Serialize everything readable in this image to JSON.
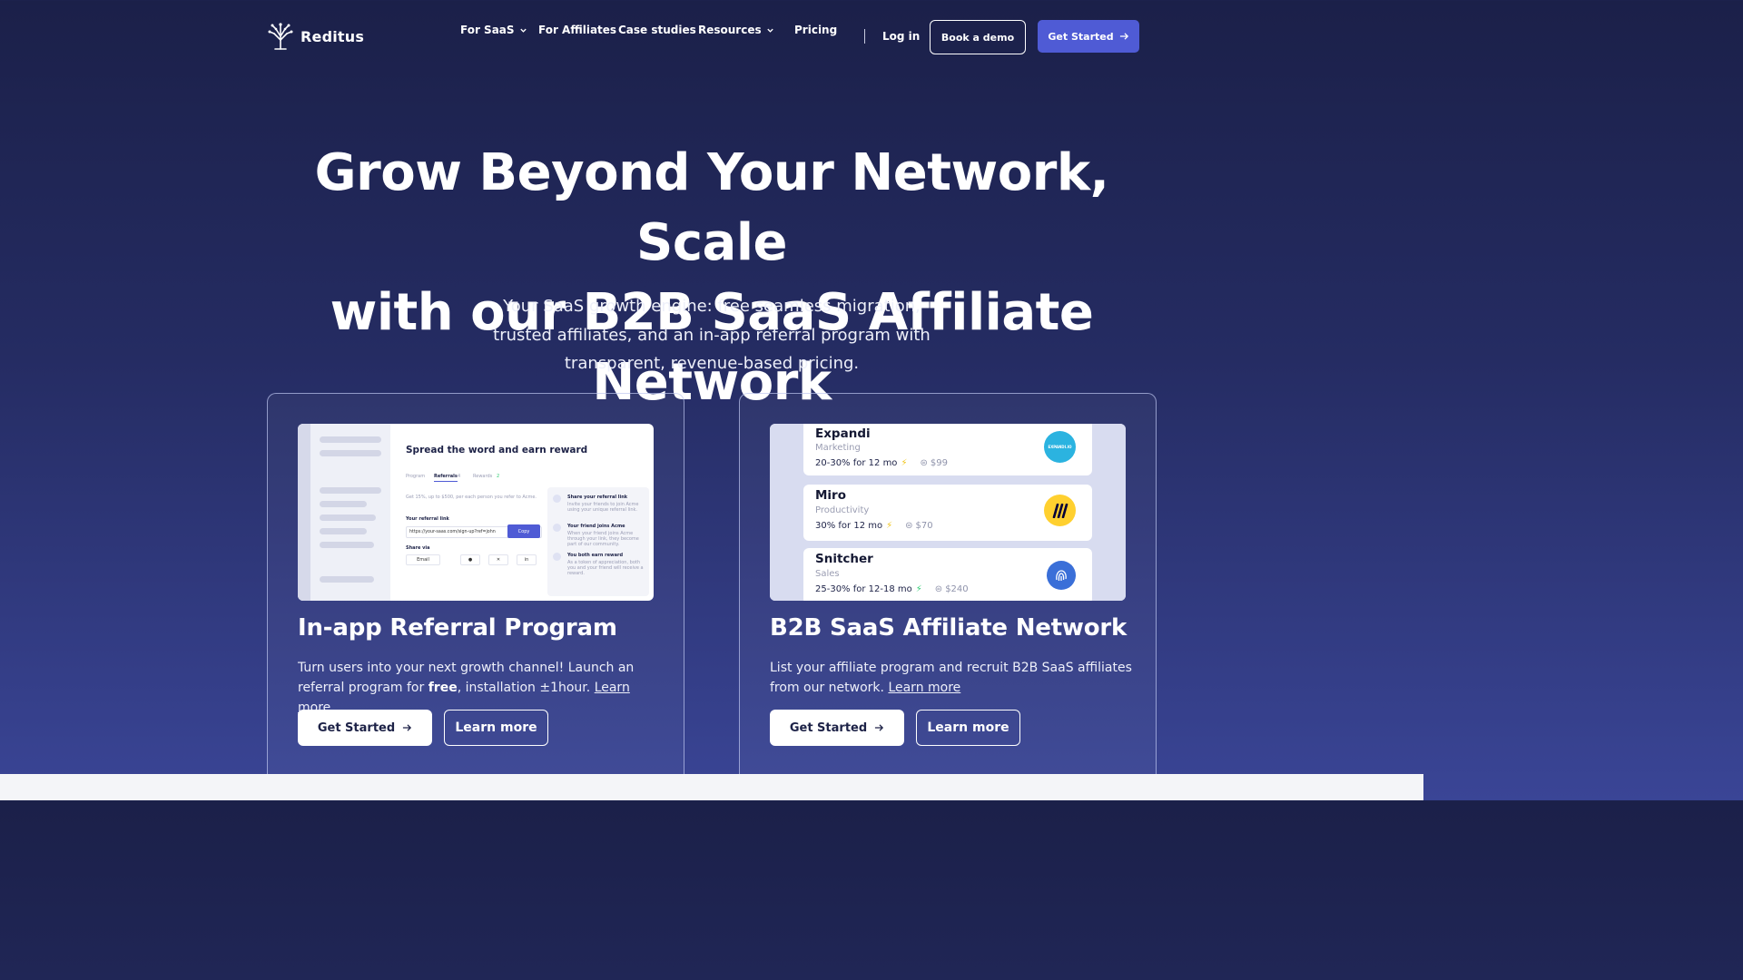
{
  "brand": {
    "name": "Reditus"
  },
  "nav": {
    "links": [
      "For SaaS",
      "For Affiliates",
      "Case studies",
      "Resources",
      "Pricing"
    ],
    "login": "Log in",
    "book_demo": "Book a demo",
    "get_started": "Get Started"
  },
  "hero": {
    "title_line1": "Grow Beyond Your Network, Scale",
    "title_line2": "with our B2B SaaS Affiliate Network",
    "subtitle_line1": "Your SaaS growth engine: free seamless migration,",
    "subtitle_line2": "trusted affiliates, and an in-app referral program with",
    "subtitle_line3": "transparent, revenue-based pricing."
  },
  "cards": [
    {
      "title": "In-app Referral Program",
      "text_pre": "Turn users into your next growth channel! Launch an referral program for ",
      "text_bold": "free",
      "text_post": ", installation ±1hour. ",
      "link": "Learn more",
      "primary": "Get Started",
      "secondary": "Learn more",
      "mock": {
        "title": "Spread the word and earn reward",
        "tabs": [
          "Program",
          "Referrals",
          "Rewards"
        ],
        "tab_counts": [
          "4",
          "2"
        ],
        "intro": "Get 15%, up to $500, per each person you refer to Acme.",
        "link_label": "Your referral link",
        "link_value": "https://your-saas.com/sign-up?ref=john",
        "copy": "Copy",
        "share_label": "Share via",
        "share_email": "Email",
        "steps": [
          {
            "title": "Share your referral link",
            "desc": "Invite your friends to join Acme using your unique referral link."
          },
          {
            "title": "Your friend joins Acme",
            "desc": "When your friend joins Acme through your link, they become part of our community."
          },
          {
            "title": "You both earn reward",
            "desc": "As a token of appreciation, both you and your friend will receive a reward."
          }
        ]
      }
    },
    {
      "title": "B2B SaaS Affiliate Network",
      "text_pre": "List your affiliate program and recruit B2B SaaS affiliates from our network. ",
      "link": "Learn more",
      "primary": "Get Started",
      "secondary": "Learn more",
      "affiliates": [
        {
          "name": "Expandi",
          "category": "Marketing",
          "commission": "20-30% for 12 mo",
          "price": "$99",
          "logo_color": "#2bb3e0",
          "icon": "expandi-logo-icon",
          "logo_text": "EXPANDI.IO"
        },
        {
          "name": "Miro",
          "category": "Productivity",
          "commission": "30% for 12 mo",
          "price": "$70",
          "logo_color": "#ffd02f",
          "icon": "miro-logo-icon",
          "logo_text": ""
        },
        {
          "name": "Snitcher",
          "category": "Sales",
          "commission": "25-30% for 12-18 mo",
          "price": "$240",
          "logo_color": "#3a6fd8",
          "icon": "snitcher-logo-icon",
          "logo_text": ""
        }
      ]
    }
  ]
}
